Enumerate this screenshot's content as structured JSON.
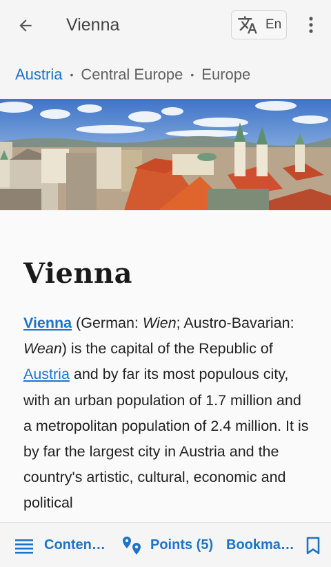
{
  "appbar": {
    "back_icon": "arrow-left-icon",
    "title": "Vienna",
    "language_icon": "translate-icon",
    "language_code": "En",
    "more_icon": "more-vertical-icon"
  },
  "breadcrumb": {
    "items": [
      "Austria",
      "Central Europe",
      "Europe"
    ],
    "separator": "•"
  },
  "hero_image": {
    "subject": "Vienna rooftops panorama"
  },
  "article": {
    "title": "Vienna",
    "p1": {
      "link_vienna": "Vienna",
      "t1": " (German: ",
      "wien": "Wien",
      "t2": "; Austro-Bavarian: ",
      "wean": "Wean",
      "t3": ") is the capital of the Republic of ",
      "link_austria": "Austria",
      "t4": " and by far its most populous city, with an urban population of 1.7 million and a metropolitan population of 2.4 million. It is by far the largest city in Austria and the country's artistic, cultural, economic and political"
    }
  },
  "bottom_bar": {
    "contents_label": "Conten…",
    "contents_icon": "list-icon",
    "points_label": "Points (5)",
    "points_icon": "map-pins-icon",
    "bookmarks_label": "Bookma…",
    "bookmarks_icon": "bookmark-icon"
  },
  "colors": {
    "accent": "#1e73c8",
    "bar_background": "#f5f5f5",
    "text": "#212121"
  }
}
